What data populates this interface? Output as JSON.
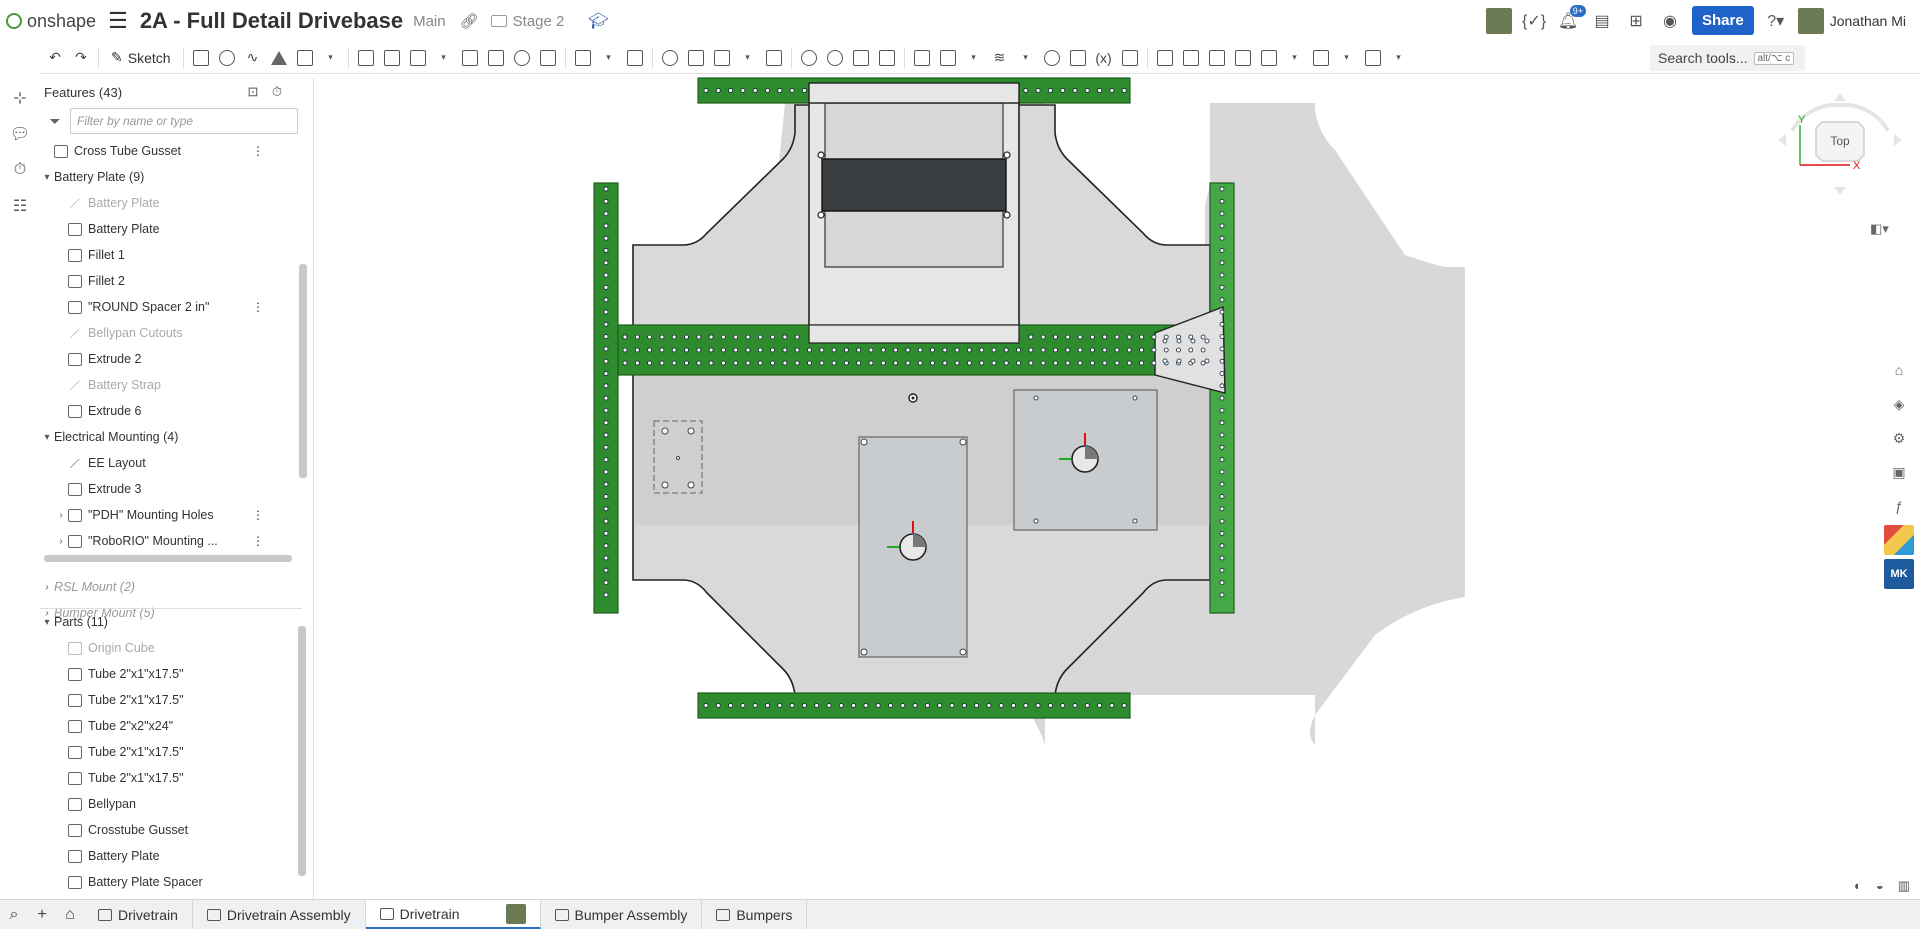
{
  "app": {
    "brand": "onshape",
    "document_title": "2A - Full Detail Drivebase",
    "branch": "Main",
    "workspace": "Stage 2",
    "notification_count": "9+",
    "share_label": "Share",
    "user_name": "Jonathan Mi"
  },
  "toolbar": {
    "sketch_label": "Sketch",
    "search_label": "Search tools...",
    "search_shortcut": "alt/⌥ c"
  },
  "feature_panel": {
    "header": "Features (43)",
    "filter_placeholder": "Filter by name or type",
    "items": [
      {
        "label": "Cross Tube Gusset",
        "kind": "part",
        "indent": 0,
        "dim": false
      },
      {
        "label": "Battery Plate (9)",
        "kind": "group",
        "indent": 0,
        "dim": false
      },
      {
        "label": "Battery Plate",
        "kind": "sketch",
        "indent": 1,
        "dim": true
      },
      {
        "label": "Battery Plate",
        "kind": "feature",
        "indent": 1,
        "dim": false
      },
      {
        "label": "Fillet 1",
        "kind": "feature",
        "indent": 1,
        "dim": false
      },
      {
        "label": "Fillet 2",
        "kind": "feature",
        "indent": 1,
        "dim": false
      },
      {
        "label": "\"ROUND Spacer 2 in\"",
        "kind": "custom",
        "indent": 1,
        "dim": false
      },
      {
        "label": "Bellypan Cutouts",
        "kind": "sketch",
        "indent": 1,
        "dim": true
      },
      {
        "label": "Extrude 2",
        "kind": "feature",
        "indent": 1,
        "dim": false
      },
      {
        "label": "Battery Strap",
        "kind": "sketch",
        "indent": 1,
        "dim": true
      },
      {
        "label": "Extrude 6",
        "kind": "feature",
        "indent": 1,
        "dim": false
      },
      {
        "label": "Electrical Mounting (4)",
        "kind": "group",
        "indent": 0,
        "dim": false
      },
      {
        "label": "EE Layout",
        "kind": "sketch",
        "indent": 1,
        "dim": false
      },
      {
        "label": "Extrude 3",
        "kind": "feature",
        "indent": 1,
        "dim": false
      },
      {
        "label": "\"PDH\" Mounting Holes",
        "kind": "pattern",
        "indent": 1,
        "dim": false
      },
      {
        "label": "\"RoboRIO\" Mounting ...",
        "kind": "pattern",
        "indent": 1,
        "dim": false
      }
    ],
    "collapsed_groups": [
      "RSL Mount (2)",
      "Bumper Mount (5)"
    ],
    "parts_header": "Parts (11)",
    "parts": [
      "Origin Cube",
      "Tube 2\"x1\"x17.5\"",
      "Tube 2\"x1\"x17.5\"",
      "Tube 2\"x2\"x24\"",
      "Tube 2\"x1\"x17.5\"",
      "Tube 2\"x1\"x17.5\"",
      "Bellypan",
      "Crosstube Gusset",
      "Battery Plate",
      "Battery Plate Spacer"
    ]
  },
  "viewcube": {
    "face_label": "Top",
    "axis_y": "Y",
    "axis_x": "X"
  },
  "tabs": [
    {
      "label": "Drivetrain",
      "type": "folder",
      "active": false
    },
    {
      "label": "Drivetrain Assembly",
      "type": "assembly",
      "active": false
    },
    {
      "label": "Drivetrain",
      "type": "partstudio",
      "active": true
    },
    {
      "label": "Bumper Assembly",
      "type": "assembly",
      "active": false
    },
    {
      "label": "Bumpers",
      "type": "partstudio",
      "active": false
    }
  ],
  "colors": {
    "tube_green": "#2f8f2f",
    "plate_gray": "#d5d5d5",
    "accent_blue": "#1f63c8"
  }
}
